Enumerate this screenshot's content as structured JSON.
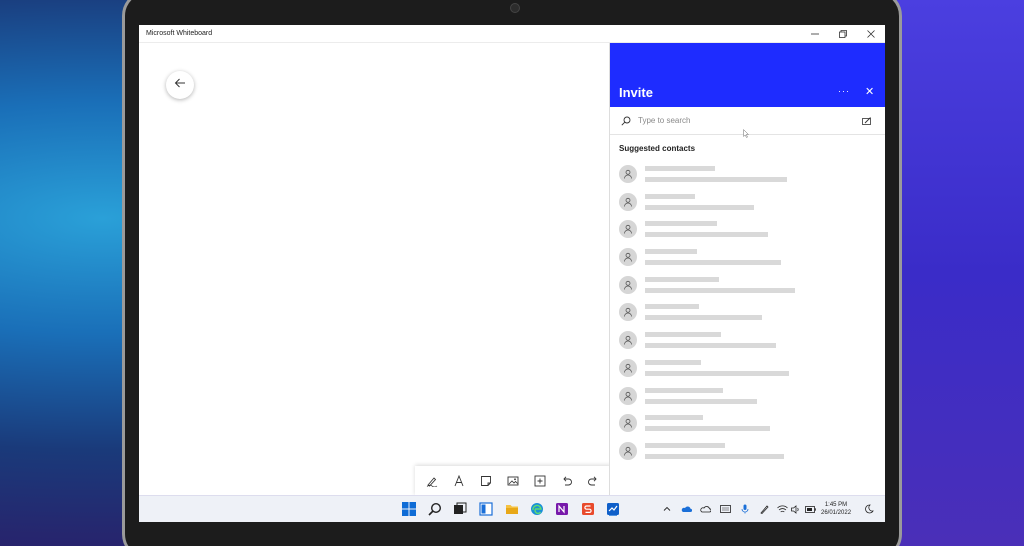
{
  "window": {
    "title": "Microsoft Whiteboard"
  },
  "invite": {
    "title": "Invite",
    "more_label": "···",
    "close_label": "✕",
    "search_placeholder": "Type to search",
    "suggested_title": "Suggested contacts"
  },
  "contacts": [
    {
      "w1": 70,
      "w2": 142
    },
    {
      "w1": 50,
      "w2": 109
    },
    {
      "w1": 72,
      "w2": 123
    },
    {
      "w1": 52,
      "w2": 136
    },
    {
      "w1": 74,
      "w2": 150
    },
    {
      "w1": 54,
      "w2": 117
    },
    {
      "w1": 76,
      "w2": 131
    },
    {
      "w1": 56,
      "w2": 144
    },
    {
      "w1": 78,
      "w2": 112
    },
    {
      "w1": 58,
      "w2": 125
    },
    {
      "w1": 80,
      "w2": 139
    }
  ],
  "toolbar": {
    "tools": [
      "pen-tool-icon",
      "text-tool-icon",
      "sticky-note-icon",
      "image-icon",
      "add-icon",
      "undo-icon",
      "redo-icon"
    ]
  },
  "taskbar": {
    "time": "1:45 PM",
    "date": "26/01/2022"
  },
  "colors": {
    "accent": "#1e2cff"
  }
}
